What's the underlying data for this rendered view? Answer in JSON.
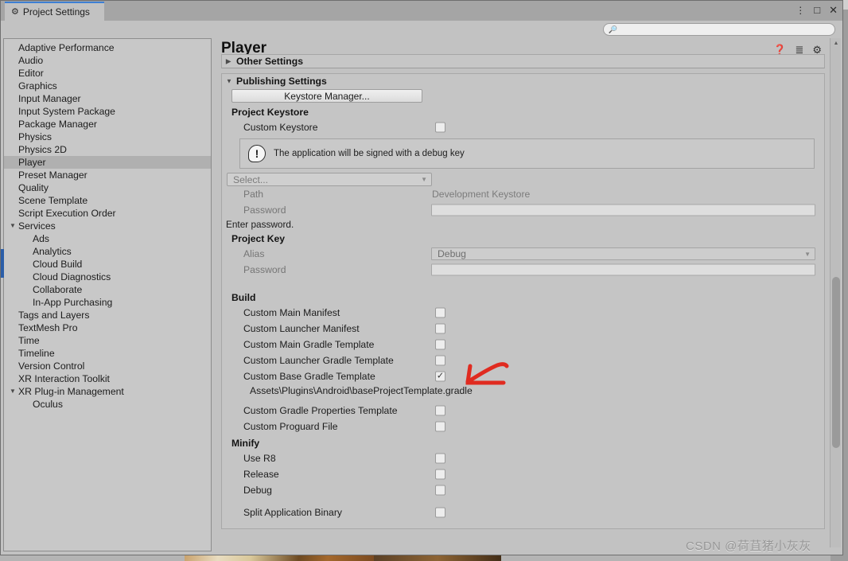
{
  "window": {
    "tab_label": "Project Settings",
    "tab_icon": "gear-icon",
    "minimize_label": "⋮",
    "maximize_label": "□",
    "close_label": "✕"
  },
  "search": {
    "placeholder": "",
    "value": "",
    "icon": "search-icon"
  },
  "sidebar": {
    "items": [
      {
        "label": "Adaptive Performance",
        "child": false,
        "arrow": "",
        "selected": false
      },
      {
        "label": "Audio",
        "child": false,
        "arrow": "",
        "selected": false
      },
      {
        "label": "Editor",
        "child": false,
        "arrow": "",
        "selected": false
      },
      {
        "label": "Graphics",
        "child": false,
        "arrow": "",
        "selected": false
      },
      {
        "label": "Input Manager",
        "child": false,
        "arrow": "",
        "selected": false
      },
      {
        "label": "Input System Package",
        "child": false,
        "arrow": "",
        "selected": false
      },
      {
        "label": "Package Manager",
        "child": false,
        "arrow": "",
        "selected": false
      },
      {
        "label": "Physics",
        "child": false,
        "arrow": "",
        "selected": false
      },
      {
        "label": "Physics 2D",
        "child": false,
        "arrow": "",
        "selected": false
      },
      {
        "label": "Player",
        "child": false,
        "arrow": "",
        "selected": true
      },
      {
        "label": "Preset Manager",
        "child": false,
        "arrow": "",
        "selected": false
      },
      {
        "label": "Quality",
        "child": false,
        "arrow": "",
        "selected": false
      },
      {
        "label": "Scene Template",
        "child": false,
        "arrow": "",
        "selected": false
      },
      {
        "label": "Script Execution Order",
        "child": false,
        "arrow": "",
        "selected": false
      },
      {
        "label": "Services",
        "child": false,
        "arrow": "▼",
        "selected": false
      },
      {
        "label": "Ads",
        "child": true,
        "arrow": "",
        "selected": false
      },
      {
        "label": "Analytics",
        "child": true,
        "arrow": "",
        "selected": false
      },
      {
        "label": "Cloud Build",
        "child": true,
        "arrow": "",
        "selected": false
      },
      {
        "label": "Cloud Diagnostics",
        "child": true,
        "arrow": "",
        "selected": false
      },
      {
        "label": "Collaborate",
        "child": true,
        "arrow": "",
        "selected": false
      },
      {
        "label": "In-App Purchasing",
        "child": true,
        "arrow": "",
        "selected": false
      },
      {
        "label": "Tags and Layers",
        "child": false,
        "arrow": "",
        "selected": false
      },
      {
        "label": "TextMesh Pro",
        "child": false,
        "arrow": "",
        "selected": false
      },
      {
        "label": "Time",
        "child": false,
        "arrow": "",
        "selected": false
      },
      {
        "label": "Timeline",
        "child": false,
        "arrow": "",
        "selected": false
      },
      {
        "label": "Version Control",
        "child": false,
        "arrow": "",
        "selected": false
      },
      {
        "label": "XR Interaction Toolkit",
        "child": false,
        "arrow": "",
        "selected": false
      },
      {
        "label": "XR Plug-in Management",
        "child": false,
        "arrow": "▼",
        "selected": false
      },
      {
        "label": "Oculus",
        "child": true,
        "arrow": "",
        "selected": false
      }
    ]
  },
  "main": {
    "title": "Player",
    "toolbar_icons": [
      "help-icon",
      "preset-icon",
      "gear-icon"
    ],
    "other_settings": {
      "label": "Other Settings",
      "arrow": "▶"
    },
    "publishing_settings": {
      "label": "Publishing Settings",
      "arrow": "▼",
      "keystore_manager_button": "Keystore Manager...",
      "project_keystore": {
        "heading": "Project Keystore",
        "custom_keystore_label": "Custom Keystore",
        "custom_keystore_checked": false,
        "helpbox_icon": "!",
        "helpbox_text": "The application will be signed with a debug key",
        "select_placeholder": "Select...",
        "path_label": "Path",
        "path_value": "Development Keystore",
        "password_label": "Password",
        "password_value": "",
        "password_note": "Enter password."
      },
      "project_key": {
        "heading": "Project Key",
        "alias_label": "Alias",
        "alias_value": "Debug",
        "password_label": "Password",
        "password_value": ""
      },
      "build": {
        "heading": "Build",
        "rows": [
          {
            "label": "Custom Main Manifest",
            "checked": false
          },
          {
            "label": "Custom Launcher Manifest",
            "checked": false
          },
          {
            "label": "Custom Main Gradle Template",
            "checked": false
          },
          {
            "label": "Custom Launcher Gradle Template",
            "checked": false
          },
          {
            "label": "Custom Base Gradle Template",
            "checked": true
          }
        ],
        "base_gradle_path": "Assets\\Plugins\\Android\\baseProjectTemplate.gradle",
        "rows2": [
          {
            "label": "Custom Gradle Properties Template",
            "checked": false
          },
          {
            "label": "Custom Proguard File",
            "checked": false
          }
        ]
      },
      "minify": {
        "heading": "Minify",
        "rows": [
          {
            "label": "Use R8",
            "checked": false
          },
          {
            "label": "Release",
            "checked": false
          },
          {
            "label": "Debug",
            "checked": false
          }
        ]
      },
      "split_application_binary": {
        "label": "Split Application Binary",
        "checked": false
      }
    }
  },
  "annotation": {
    "type": "hand-drawn-arrow",
    "color": "#e02b20",
    "points_to": "Custom Base Gradle Template checkbox"
  },
  "watermark": {
    "text": "CSDN @荷苴猪小灰灰"
  },
  "colors": {
    "window_bg": "#c2c2c2",
    "sidebar_bg": "#c8c8c8",
    "selection": "#b0b0b0",
    "tab_accent": "#3d7fd4",
    "annotation_red": "#e02b20"
  }
}
